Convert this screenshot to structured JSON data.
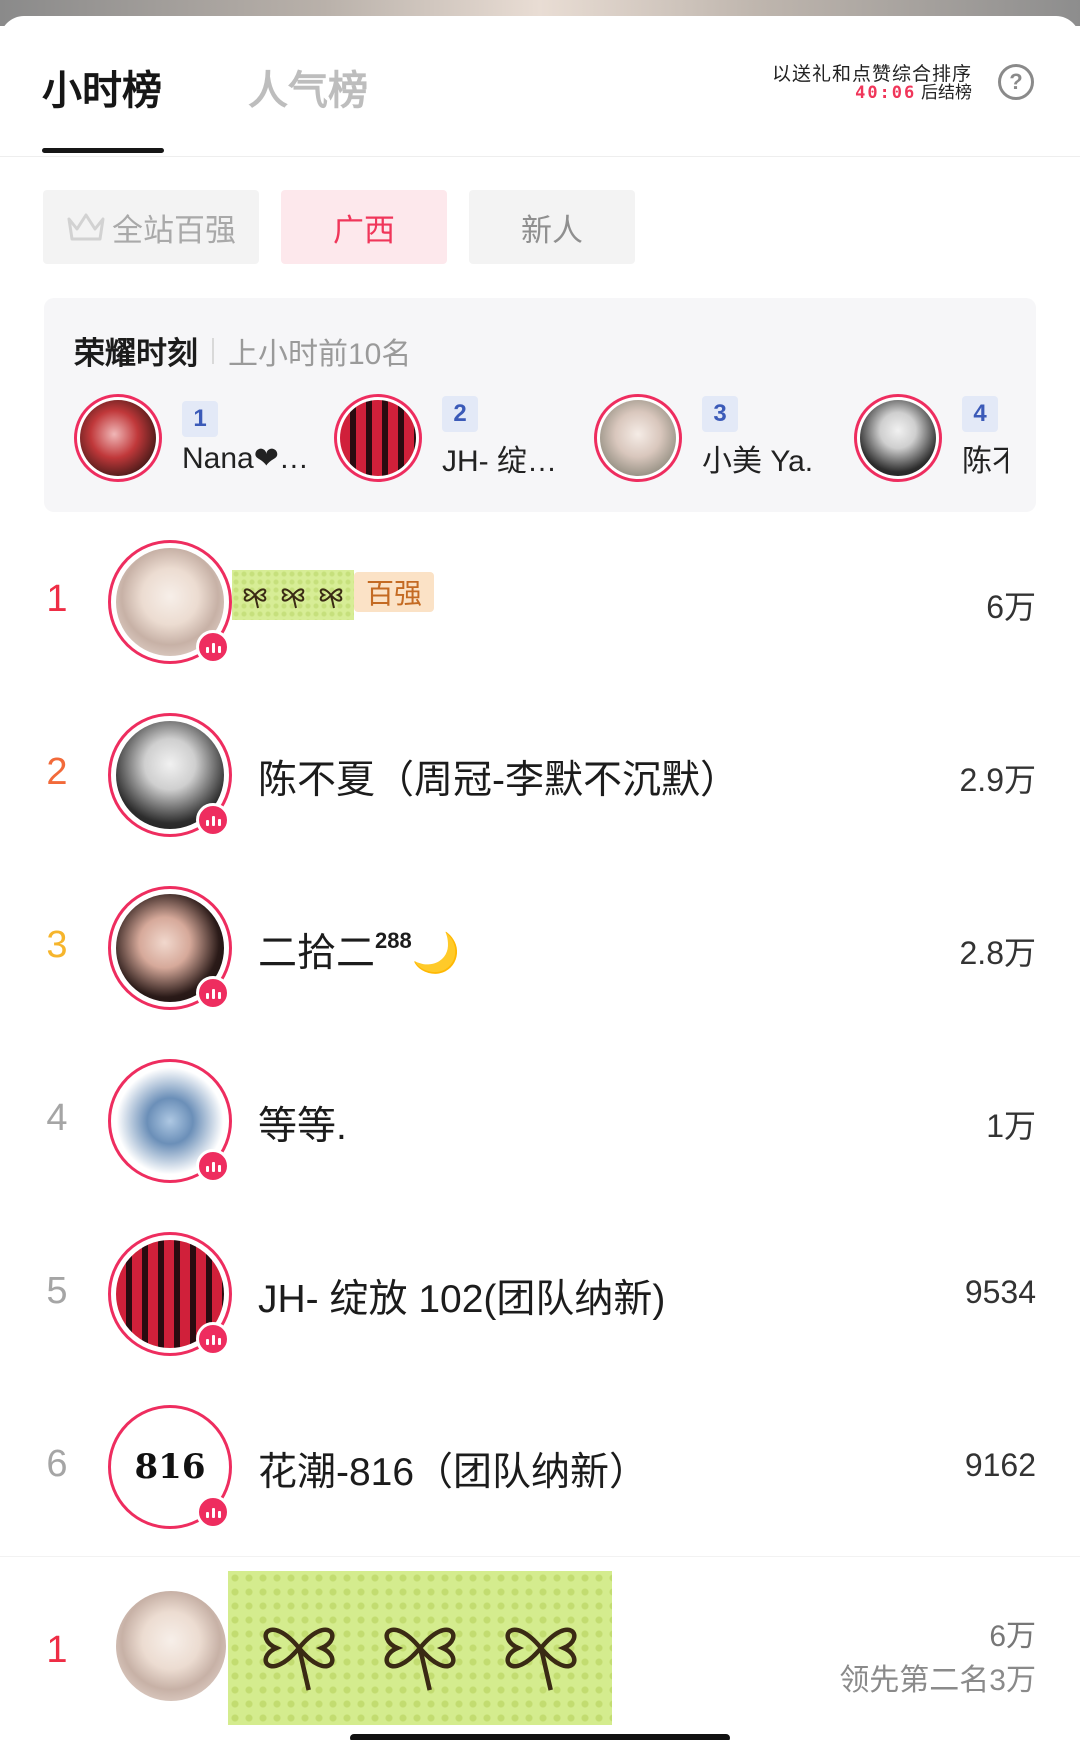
{
  "header": {
    "tabs": [
      {
        "label": "小时榜",
        "active": true
      },
      {
        "label": "人气榜",
        "active": false
      }
    ],
    "sort_line1": "以送礼和点赞综合排序",
    "countdown": "40:06",
    "sort_line2_suffix": "后结榜",
    "help_icon": "?"
  },
  "chips": [
    {
      "label": "全站百强",
      "icon": "crown-icon"
    },
    {
      "label": "广西",
      "selected": true
    },
    {
      "label": "新人"
    }
  ],
  "honor": {
    "title": "荣耀时刻",
    "subtitle": "上小时前10名",
    "items": [
      {
        "rank": "1",
        "name": "Nana❤…"
      },
      {
        "rank": "2",
        "name": "JH- 绽…"
      },
      {
        "rank": "3",
        "name": "小美 Ya."
      },
      {
        "rank": "4",
        "name": "陈不"
      }
    ]
  },
  "list": [
    {
      "rank": "1",
      "name": "",
      "badge": "百强",
      "score": "6万"
    },
    {
      "rank": "2",
      "name": "陈不夏（周冠-李默不沉默）",
      "score": "2.9万"
    },
    {
      "rank": "3",
      "name": "二拾二",
      "superscript": "288",
      "emoji": "🌙",
      "score": "2.8万"
    },
    {
      "rank": "4",
      "name": "等等.",
      "score": "1万"
    },
    {
      "rank": "5",
      "name": "JH- 绽放 102(团队纳新)",
      "score": "9534"
    },
    {
      "rank": "6",
      "name": "花潮-816（团队纳新）",
      "score": "9162",
      "avatar_text": "816"
    }
  ],
  "footer": {
    "rank": "1",
    "score": "6万",
    "lead_text": "领先第二名3万"
  },
  "colors": {
    "accent": "#ee2d5f",
    "rank1": "#ee2d45",
    "rank2": "#f26a3a",
    "rank3": "#f6b52c",
    "badge_bg": "#fbe2c6"
  }
}
